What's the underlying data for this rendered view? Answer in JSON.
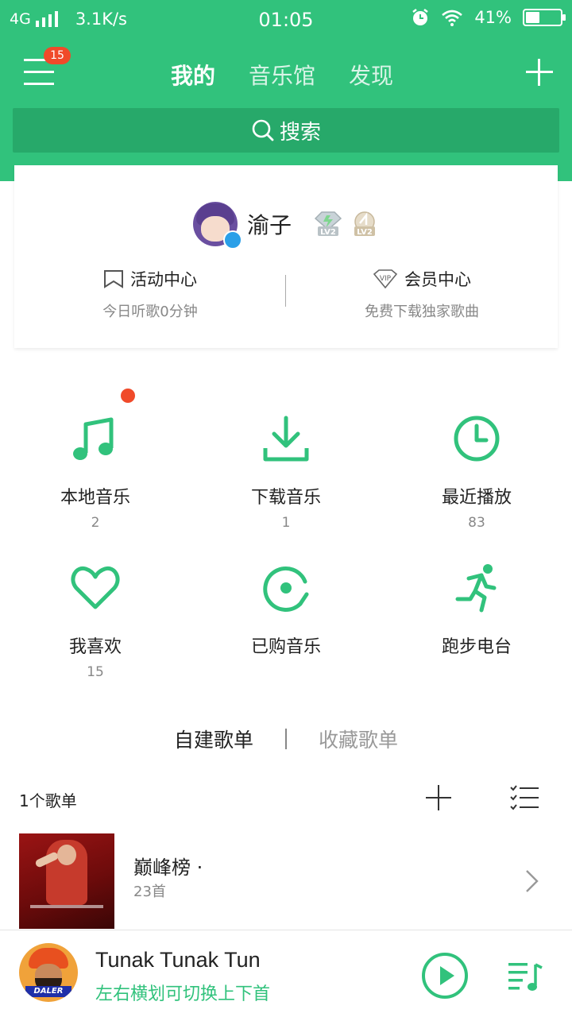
{
  "status_bar": {
    "network": "4G",
    "speed": "3.1K/s",
    "time": "01:05",
    "battery_percent": "41%",
    "battery_level": 0.41
  },
  "nav": {
    "menu_badge": "15",
    "tabs": [
      {
        "label": "我的",
        "active": true
      },
      {
        "label": "音乐馆",
        "active": false
      },
      {
        "label": "发现",
        "active": false
      }
    ]
  },
  "search": {
    "label": "搜索"
  },
  "profile": {
    "username": "渝子",
    "badges": [
      "LV2",
      "LV2"
    ],
    "links": [
      {
        "title": "活动中心",
        "subtitle": "今日听歌0分钟"
      },
      {
        "title": "会员中心",
        "subtitle": "免费下载独家歌曲"
      }
    ]
  },
  "features": [
    {
      "label": "本地音乐",
      "count": "2"
    },
    {
      "label": "下载音乐",
      "count": "1"
    },
    {
      "label": "最近播放",
      "count": "83"
    },
    {
      "label": "我喜欢",
      "count": "15"
    },
    {
      "label": "已购音乐",
      "count": ""
    },
    {
      "label": "跑步电台",
      "count": ""
    }
  ],
  "playlist_tabs": [
    {
      "label": "自建歌单",
      "active": true
    },
    {
      "label": "收藏歌单",
      "active": false
    }
  ],
  "playlist_section": {
    "count_label": "1个歌单",
    "items": [
      {
        "name": "巅峰榜 ·",
        "songs": "23首"
      }
    ]
  },
  "mini_player": {
    "title": "Tunak Tunak Tun",
    "hint": "左右横划可切换上下首",
    "cover_label": "DALER"
  },
  "colors": {
    "brand_green": "#31c27c",
    "search_green": "#27a96a",
    "badge_red": "#f04a2a"
  }
}
